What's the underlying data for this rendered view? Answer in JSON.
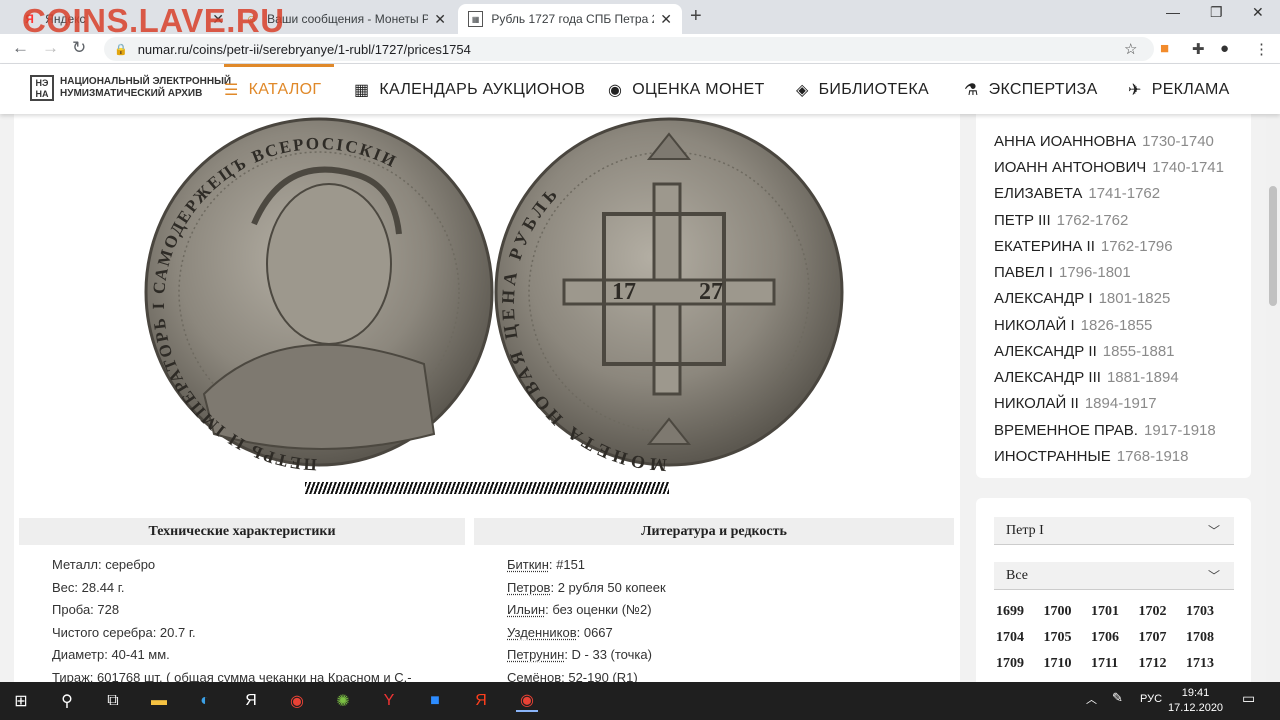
{
  "watermark": "COINS.LAVE.RU",
  "tabs": [
    {
      "title": "Яндекс",
      "icon": "yandex-icon"
    },
    {
      "title": "Ваши сообщения - Монеты Рос",
      "icon": "forum-icon"
    },
    {
      "title": "Рубль 1727 года СПБ Петра 2 (с",
      "icon": "numar-icon"
    }
  ],
  "new_tab": "+",
  "address": "numar.ru/coins/petr-ii/serebryanye/1-rubl/1727/prices1754",
  "site": {
    "logo_mark": "НЭ НА",
    "logo_line1": "НАЦИОНАЛЬНЫЙ ЭЛЕКТРОННЫЙ",
    "logo_line2": "НУМИЗМАТИЧЕСКИЙ АРХИВ",
    "menu": [
      {
        "label": "КАТАЛОГ",
        "icon": "catalog-icon"
      },
      {
        "label": "КАЛЕНДАРЬ АУКЦИОНОВ",
        "icon": "calendar-icon"
      },
      {
        "label": "ОЦЕНКА МОНЕТ",
        "icon": "coins-stack-icon"
      },
      {
        "label": "БИБЛИОТЕКА",
        "icon": "book-icon"
      },
      {
        "label": "ЭКСПЕРТИЗА",
        "icon": "flask-icon"
      },
      {
        "label": "РЕКЛАМА",
        "icon": "megaphone-icon"
      }
    ]
  },
  "coin": {
    "obverse_legend": "ПЕТРЬ II IМПЕРАТОРЬ I САМОДЕРЖЕЦЪ ВСЕРОСIСКIИ",
    "reverse_legend": "МОНЕТА НОВАЯ ЦЕНА РУБЛЬ",
    "reverse_date_left": "17",
    "reverse_date_right": "27"
  },
  "tech": {
    "header": "Технические характеристики",
    "lines": [
      "Металл: серебро",
      "Вес: 28.44 г.",
      "Проба: 728",
      "Чистого серебра: 20.7 г.",
      "Диаметр: 40-41 мм.",
      "Тираж: 601768 шт. ( общая сумма чеканки на Красном и С.-"
    ]
  },
  "literature": {
    "header": "Литература и редкость",
    "items": [
      {
        "name": "Биткин",
        "value": ": #151"
      },
      {
        "name": "Петров",
        "value": ": 2 рубля 50 копеек"
      },
      {
        "name": "Ильин",
        "value": ": без оценки (№2)"
      },
      {
        "name": "Узденников",
        "value": ": 0667"
      },
      {
        "name": "Петрунин",
        "value": ": D - 33 (точка)"
      },
      {
        "name": "Семёнов",
        "value": ": 52-190 (R1)"
      }
    ]
  },
  "rulers": [
    {
      "name": "АННА ИОАННОВНА",
      "years": "1730-1740"
    },
    {
      "name": "ИОАНН АНТОНОВИЧ",
      "years": "1740-1741"
    },
    {
      "name": "ЕЛИЗАВЕТА",
      "years": "1741-1762"
    },
    {
      "name": "ПЕТР III",
      "years": "1762-1762"
    },
    {
      "name": "ЕКАТЕРИНА II",
      "years": "1762-1796"
    },
    {
      "name": "ПАВЕЛ I",
      "years": "1796-1801"
    },
    {
      "name": "АЛЕКСАНДР I",
      "years": "1801-1825"
    },
    {
      "name": "НИКОЛАЙ I",
      "years": "1826-1855"
    },
    {
      "name": "АЛЕКСАНДР II",
      "years": "1855-1881"
    },
    {
      "name": "АЛЕКСАНДР III",
      "years": "1881-1894"
    },
    {
      "name": "НИКОЛАЙ II",
      "years": "1894-1917"
    },
    {
      "name": "ВРЕМЕННОЕ ПРАВ.",
      "years": "1917-1918"
    },
    {
      "name": "ИНОСТРАННЫЕ",
      "years": "1768-1918"
    }
  ],
  "filters": {
    "ruler_select": "Петр I",
    "type_select": "Все",
    "years": [
      "1699",
      "1700",
      "1701",
      "1702",
      "1703",
      "1704",
      "1705",
      "1706",
      "1707",
      "1708",
      "1709",
      "1710",
      "1711",
      "1712",
      "1713"
    ]
  },
  "taskbar": {
    "lang": "РУС",
    "time": "19:41",
    "date": "17.12.2020"
  },
  "colors": {
    "accent": "#e0892a",
    "watermark": "#d9412b",
    "taskbar": "#1f1f1f"
  }
}
